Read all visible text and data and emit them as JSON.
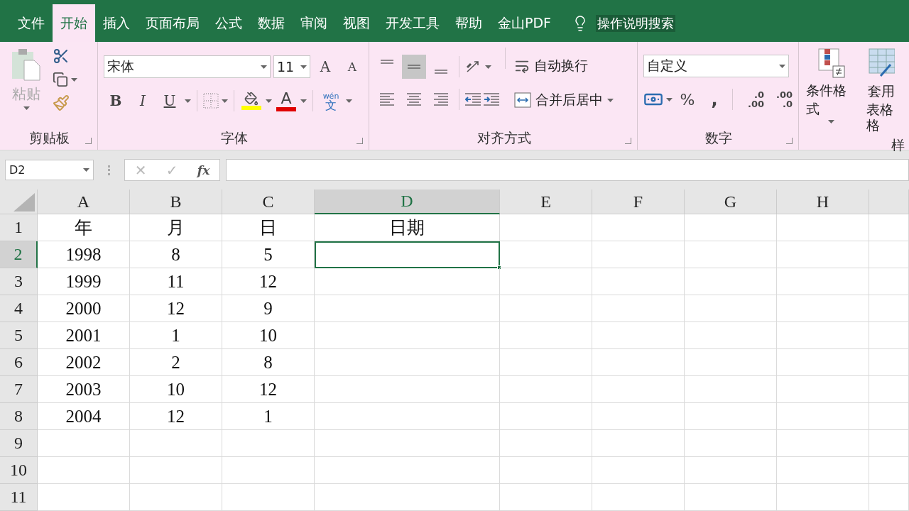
{
  "menu_tabs": [
    {
      "label": "文件",
      "selected": false
    },
    {
      "label": "开始",
      "selected": true
    },
    {
      "label": "插入",
      "selected": false
    },
    {
      "label": "页面布局",
      "selected": false
    },
    {
      "label": "公式",
      "selected": false
    },
    {
      "label": "数据",
      "selected": false
    },
    {
      "label": "审阅",
      "selected": false
    },
    {
      "label": "视图",
      "selected": false
    },
    {
      "label": "开发工具",
      "selected": false
    },
    {
      "label": "帮助",
      "selected": false
    },
    {
      "label": "金山PDF",
      "selected": false
    }
  ],
  "search": {
    "placeholder": "操作说明搜索"
  },
  "ribbon": {
    "clipboard": {
      "label": "剪贴板",
      "paste": "粘贴"
    },
    "font": {
      "label": "字体",
      "font_name": "宋体",
      "font_size": "11",
      "grow": "A",
      "shrink": "A",
      "bold": "B",
      "italic": "I",
      "underline": "U",
      "font_color": "A",
      "phonetic_top": "wén",
      "phonetic_bottom": "文"
    },
    "alignment": {
      "label": "对齐方式",
      "vertical": [
        {
          "selected": false
        },
        {
          "selected": true
        },
        {
          "selected": false
        }
      ],
      "horizontal": [
        {
          "selected": false
        },
        {
          "selected": false
        },
        {
          "selected": false
        }
      ],
      "wrap_text": "自动换行",
      "merge": "合并后居中"
    },
    "number": {
      "label": "数字",
      "format": "自定义",
      "percent": "%",
      "comma": ",",
      "increase_decimal": [
        ".0",
        ".00"
      ],
      "decrease_decimal": [
        ".00",
        ".0"
      ]
    },
    "styles": {
      "conditional": "条件格式",
      "table_top": "套用",
      "table_bottom": "表格格",
      "label": "样"
    }
  },
  "formula_bar": {
    "name_box": "D2",
    "cancel": "✕",
    "enter": "✓",
    "fx": "fx"
  },
  "columns": [
    {
      "label": "A",
      "selected": false
    },
    {
      "label": "B",
      "selected": false
    },
    {
      "label": "C",
      "selected": false
    },
    {
      "label": "D",
      "selected": true
    },
    {
      "label": "E",
      "selected": false
    },
    {
      "label": "F",
      "selected": false
    },
    {
      "label": "G",
      "selected": false
    },
    {
      "label": "H",
      "selected": false
    }
  ],
  "rows": [
    {
      "number": "1",
      "selected": false,
      "cells": [
        "年",
        "月",
        "日",
        "日期"
      ]
    },
    {
      "number": "2",
      "selected": true,
      "cells": [
        "1998",
        "8",
        "5"
      ]
    },
    {
      "number": "3",
      "selected": false,
      "cells": [
        "1999",
        "11",
        "12"
      ]
    },
    {
      "number": "4",
      "selected": false,
      "cells": [
        "2000",
        "12",
        "9"
      ]
    },
    {
      "number": "5",
      "selected": false,
      "cells": [
        "2001",
        "1",
        "10"
      ]
    },
    {
      "number": "6",
      "selected": false,
      "cells": [
        "2002",
        "2",
        "8"
      ]
    },
    {
      "number": "7",
      "selected": false,
      "cells": [
        "2003",
        "10",
        "12"
      ]
    },
    {
      "number": "8",
      "selected": false,
      "cells": [
        "2004",
        "12",
        "1"
      ]
    },
    {
      "number": "9",
      "selected": false,
      "cells": []
    },
    {
      "number": "10",
      "selected": false,
      "cells": []
    },
    {
      "number": "11",
      "selected": false,
      "cells": []
    }
  ]
}
